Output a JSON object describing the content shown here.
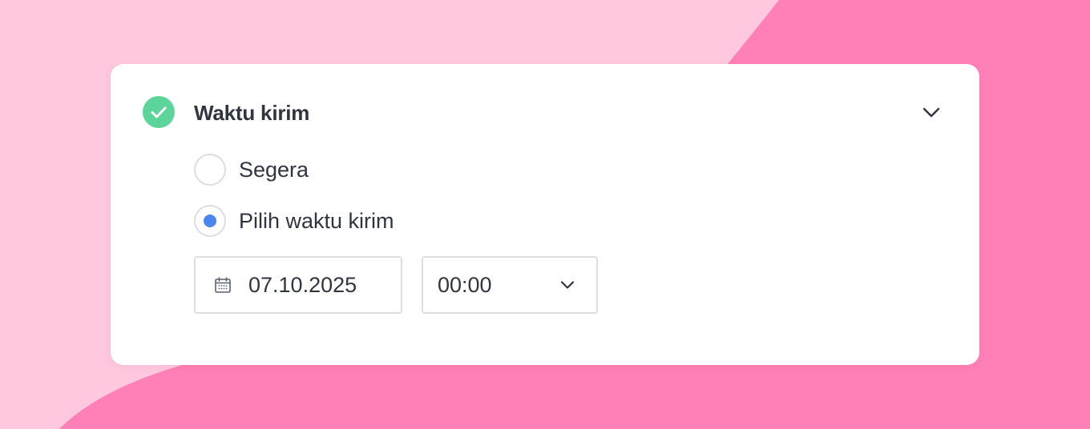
{
  "colors": {
    "background_light": "#ffc8de",
    "background_dark": "#ff80b6",
    "card": "#ffffff",
    "success": "#5cd49a",
    "accent": "#4a86ee",
    "text": "#2f3540",
    "border": "#dcdee2"
  },
  "panel": {
    "status_icon": "check-circle-icon",
    "title": "Waktu kirim",
    "toggle_icon": "chevron-down-icon",
    "expanded": true
  },
  "options": [
    {
      "label": "Segera",
      "selected": false
    },
    {
      "label": "Pilih waktu kirim",
      "selected": true
    }
  ],
  "schedule": {
    "date_icon": "calendar-icon",
    "date": "07.10.2025",
    "time": "00:00",
    "time_icon": "chevron-down-icon"
  }
}
